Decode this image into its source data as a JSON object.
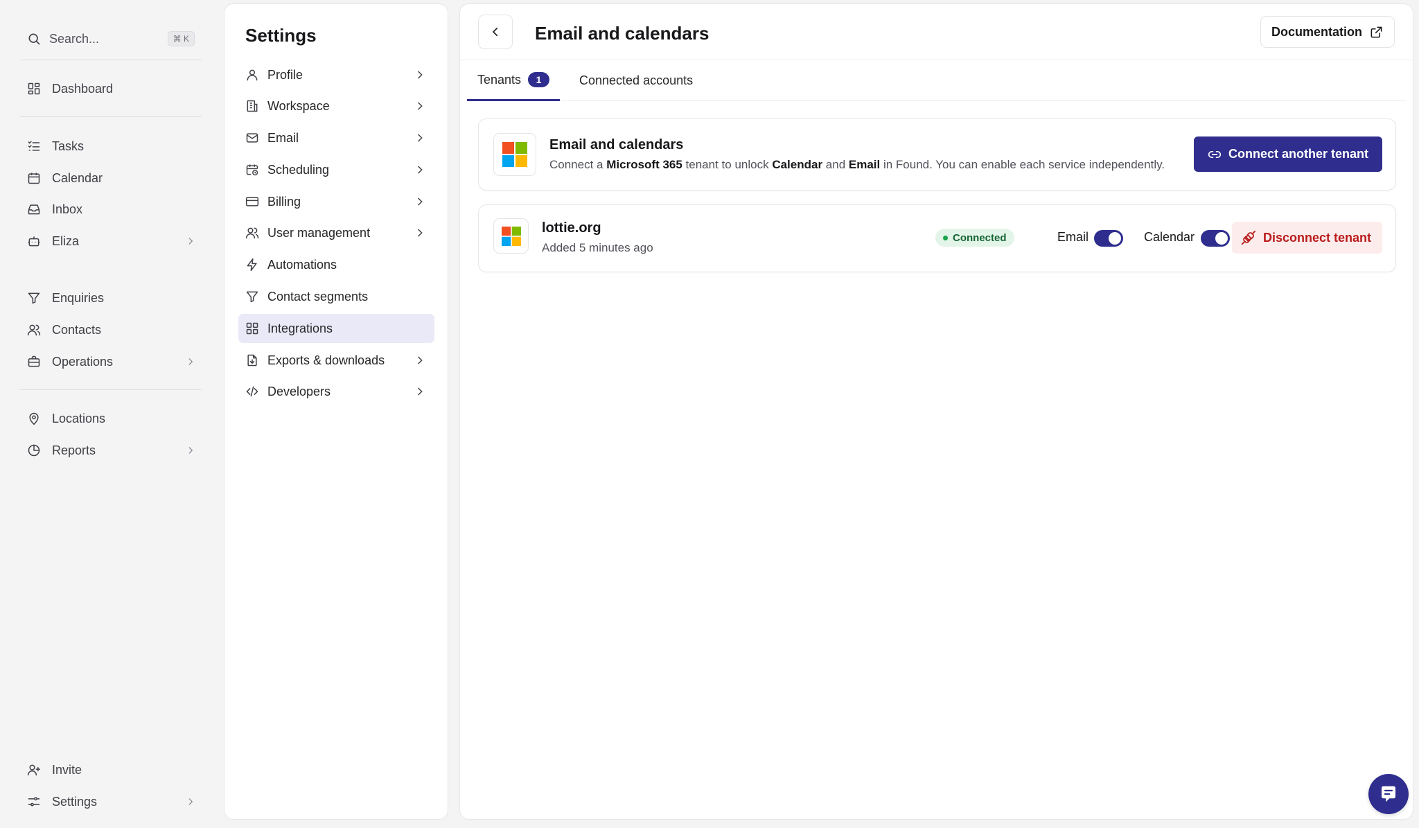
{
  "nav": {
    "search_label": "Search...",
    "search_shortcut": "⌘ K",
    "items": [
      {
        "label": "Dashboard"
      },
      {
        "label": "Tasks"
      },
      {
        "label": "Calendar"
      },
      {
        "label": "Inbox"
      },
      {
        "label": "Eliza"
      },
      {
        "label": "Enquiries"
      },
      {
        "label": "Contacts"
      },
      {
        "label": "Operations"
      },
      {
        "label": "Locations"
      },
      {
        "label": "Reports"
      },
      {
        "label": "Invite"
      },
      {
        "label": "Settings"
      }
    ]
  },
  "settings": {
    "title": "Settings",
    "items": [
      {
        "label": "Profile"
      },
      {
        "label": "Workspace"
      },
      {
        "label": "Email"
      },
      {
        "label": "Scheduling"
      },
      {
        "label": "Billing"
      },
      {
        "label": "User management"
      },
      {
        "label": "Automations"
      },
      {
        "label": "Contact segments"
      },
      {
        "label": "Integrations"
      },
      {
        "label": "Exports & downloads"
      },
      {
        "label": "Developers"
      }
    ],
    "active": "Integrations"
  },
  "header": {
    "title": "Email and calendars",
    "documentation_label": "Documentation"
  },
  "tabs": [
    {
      "label": "Tenants",
      "badge": "1"
    },
    {
      "label": "Connected accounts"
    }
  ],
  "intro": {
    "title": "Email and calendars",
    "desc_1": "Connect a ",
    "desc_b1": "Microsoft 365",
    "desc_2": " tenant to unlock ",
    "desc_b2": "Calendar",
    "desc_3": " and ",
    "desc_b3": "Email",
    "desc_4": " in Found. You can enable each service independently.",
    "connect_label": "Connect another tenant"
  },
  "tenant": {
    "name": "lottie.org",
    "added": "Added 5 minutes ago",
    "status": "Connected",
    "email_label": "Email",
    "email_enabled": true,
    "calendar_label": "Calendar",
    "calendar_enabled": true,
    "disconnect_label": "Disconnect tenant"
  },
  "colors": {
    "accent": "#2f2e8f",
    "danger": "#b91c1c",
    "success": "#16a34a",
    "ms_red": "#f25022",
    "ms_green": "#7fba00",
    "ms_blue": "#00a4ef",
    "ms_yellow": "#ffb900"
  },
  "icons": {
    "chat": "chat-bubble-icon"
  }
}
